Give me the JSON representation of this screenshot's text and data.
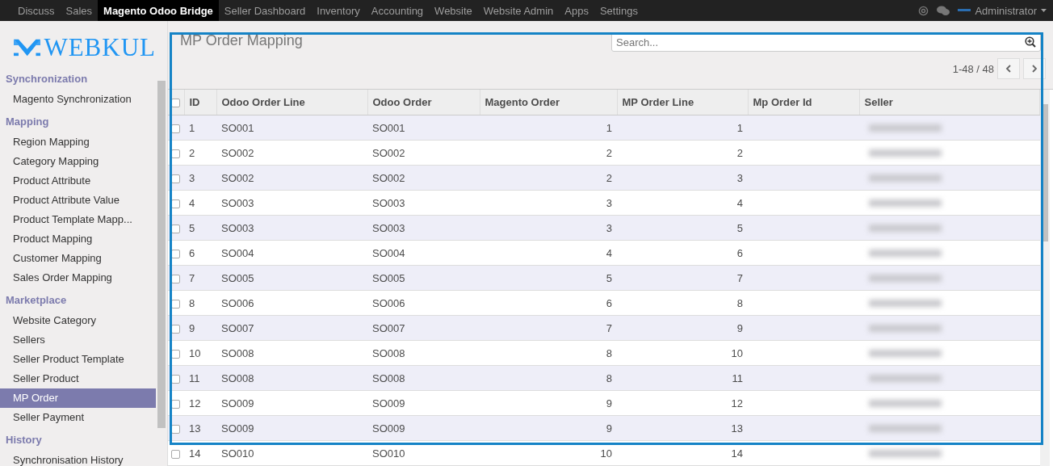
{
  "top_menu": [
    {
      "label": "Discuss",
      "selected": false
    },
    {
      "label": "Sales",
      "selected": false
    },
    {
      "label": "Magento Odoo Bridge",
      "selected": true
    },
    {
      "label": "Seller Dashboard",
      "selected": false
    },
    {
      "label": "Inventory",
      "selected": false
    },
    {
      "label": "Accounting",
      "selected": false
    },
    {
      "label": "Website",
      "selected": false
    },
    {
      "label": "Website Admin",
      "selected": false
    },
    {
      "label": "Apps",
      "selected": false
    },
    {
      "label": "Settings",
      "selected": false
    }
  ],
  "user": {
    "name": "Administrator"
  },
  "logo": {
    "text": "WEBKUL"
  },
  "sidebar": {
    "sections": [
      {
        "title": "Synchronization",
        "items": [
          {
            "label": "Magento Synchronization",
            "selected": false
          }
        ]
      },
      {
        "title": "Mapping",
        "items": [
          {
            "label": "Region Mapping",
            "selected": false
          },
          {
            "label": "Category Mapping",
            "selected": false
          },
          {
            "label": "Product Attribute",
            "selected": false
          },
          {
            "label": "Product Attribute Value",
            "selected": false
          },
          {
            "label": "Product Template Mapp...",
            "selected": false
          },
          {
            "label": "Product Mapping",
            "selected": false
          },
          {
            "label": "Customer Mapping",
            "selected": false
          },
          {
            "label": "Sales Order Mapping",
            "selected": false
          }
        ]
      },
      {
        "title": "Marketplace",
        "items": [
          {
            "label": "Website Category",
            "selected": false
          },
          {
            "label": "Sellers",
            "selected": false
          },
          {
            "label": "Seller Product Template",
            "selected": false
          },
          {
            "label": "Seller Product",
            "selected": false
          },
          {
            "label": "MP Order",
            "selected": true
          },
          {
            "label": "Seller Payment",
            "selected": false
          }
        ]
      },
      {
        "title": "History",
        "items": [
          {
            "label": "Synchronisation History",
            "selected": false
          }
        ]
      }
    ]
  },
  "page_title": "MP Order Mapping",
  "search": {
    "placeholder": "Search..."
  },
  "pager": {
    "text": "1-48 / 48"
  },
  "table": {
    "header_checked": false,
    "columns": [
      "ID",
      "Odoo Order Line",
      "Odoo Order",
      "Magento Order",
      "MP Order Line",
      "Mp Order Id",
      "Seller"
    ],
    "rows": [
      {
        "checked": false,
        "cells": [
          "1",
          "SO001",
          "SO001",
          "1",
          "1"
        ]
      },
      {
        "checked": false,
        "cells": [
          "2",
          "SO002",
          "SO002",
          "2",
          "2"
        ]
      },
      {
        "checked": false,
        "cells": [
          "3",
          "SO002",
          "SO002",
          "2",
          "3"
        ]
      },
      {
        "checked": false,
        "cells": [
          "4",
          "SO003",
          "SO003",
          "3",
          "4"
        ]
      },
      {
        "checked": false,
        "cells": [
          "5",
          "SO003",
          "SO003",
          "3",
          "5"
        ]
      },
      {
        "checked": false,
        "cells": [
          "6",
          "SO004",
          "SO004",
          "4",
          "6"
        ]
      },
      {
        "checked": false,
        "cells": [
          "7",
          "SO005",
          "SO005",
          "5",
          "7"
        ]
      },
      {
        "checked": false,
        "cells": [
          "8",
          "SO006",
          "SO006",
          "6",
          "8"
        ]
      },
      {
        "checked": false,
        "cells": [
          "9",
          "SO007",
          "SO007",
          "7",
          "9"
        ]
      },
      {
        "checked": false,
        "cells": [
          "10",
          "SO008",
          "SO008",
          "8",
          "10"
        ]
      },
      {
        "checked": false,
        "cells": [
          "11",
          "SO008",
          "SO008",
          "8",
          "11"
        ]
      },
      {
        "checked": false,
        "cells": [
          "12",
          "SO009",
          "SO009",
          "9",
          "12"
        ]
      },
      {
        "checked": false,
        "cells": [
          "13",
          "SO009",
          "SO009",
          "9",
          "13"
        ]
      },
      {
        "checked": false,
        "cells": [
          "14",
          "SO010",
          "SO010",
          "10",
          "14"
        ]
      }
    ]
  }
}
